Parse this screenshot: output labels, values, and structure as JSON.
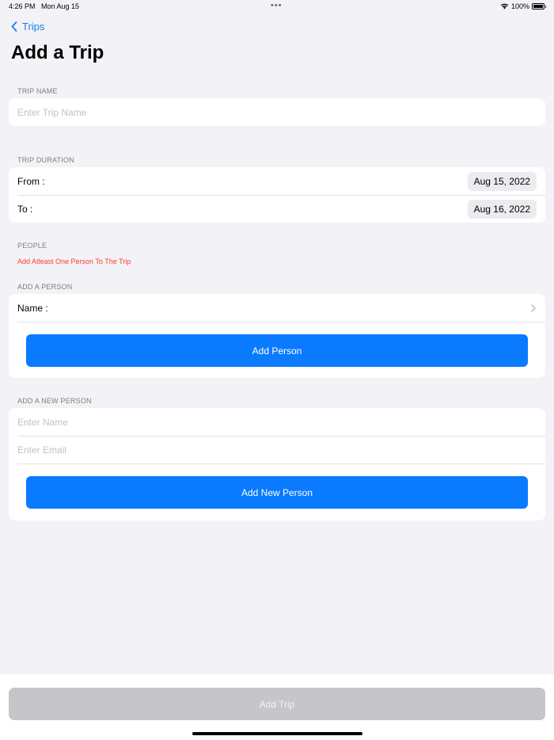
{
  "status_bar": {
    "time": "4:26 PM",
    "date": "Mon Aug 15",
    "dots": "•••",
    "battery": "100%"
  },
  "nav": {
    "back_label": "Trips"
  },
  "page": {
    "title": "Add a Trip"
  },
  "trip_name": {
    "section_label": "TRIP NAME",
    "placeholder": "Enter Trip Name"
  },
  "trip_duration": {
    "section_label": "TRIP DURATION",
    "from_label": "From :",
    "from_value": "Aug 15, 2022",
    "to_label": "To :",
    "to_value": "Aug 16, 2022"
  },
  "people": {
    "section_label": "PEOPLE",
    "error": "Add Atleast One Person To The Trip"
  },
  "add_person": {
    "section_label": "ADD A PERSON",
    "name_label": "Name :",
    "button_label": "Add Person"
  },
  "add_new_person": {
    "section_label": "ADD A NEW PERSON",
    "name_placeholder": "Enter Name",
    "email_placeholder": "Enter Email",
    "button_label": "Add New Person"
  },
  "footer": {
    "button_label": "Add Trip"
  },
  "colors": {
    "accent": "#0a7aff",
    "error": "#ff3b30",
    "disabled": "#c6c6c8",
    "background": "#f2f2f7"
  }
}
